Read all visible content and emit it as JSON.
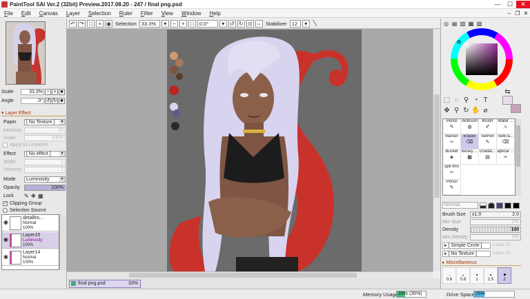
{
  "window": {
    "title": "PaintTool SAI Ver.2 (32bit) Preview.2017.08.20 - 247 / final png.psd",
    "minimize": "—",
    "maximize": "☐",
    "close": "✕"
  },
  "menu": {
    "items": [
      {
        "key": "F",
        "rest": "ile"
      },
      {
        "key": "E",
        "rest": "dit"
      },
      {
        "key": "C",
        "rest": "anvas"
      },
      {
        "key": "L",
        "rest": "ayer"
      },
      {
        "key": "S",
        "rest": "election"
      },
      {
        "key": "R",
        "rest": "uler"
      },
      {
        "key": "F",
        "rest": "ilter"
      },
      {
        "key": "V",
        "rest": "iew"
      },
      {
        "key": "W",
        "rest": "indow"
      },
      {
        "key": "H",
        "rest": "elp"
      }
    ],
    "right": [
      "–",
      "❐",
      "✕"
    ]
  },
  "toolbar": {
    "selection_label": "Selection",
    "zoom": "33.3%",
    "zoom_minus": "−",
    "zoom_plus": "+",
    "rotation": "0.0°",
    "stabilizer_label": "Stabilizer",
    "stabilizer_value": "12"
  },
  "navigator": {
    "scale_label": "Scale",
    "scale_value": "33.3%",
    "angle_label": "Angle",
    "angle_value": "0°"
  },
  "layer_effect": {
    "header": "Layer Effect",
    "paper_label": "Paper",
    "paper_value": "[ No Texture ]",
    "intensity_label": "Intensity",
    "intensity_value": "20",
    "scale_label": "Scale",
    "scale_value": "100%",
    "apply_linework": "Apply to Linework",
    "effect_label": "Effect",
    "effect_value": "[ No effect ]",
    "width_label": "Width",
    "width_value": "1",
    "intensity2_label": "Intensity",
    "intensity2_value": "1"
  },
  "layer_props": {
    "mode_label": "Mode",
    "mode_value": "Luminosity",
    "opacity_label": "Opacity",
    "opacity_value": "100%",
    "opacity_fraction": 1.0,
    "lock_label": "Lock",
    "clipping_group": "Clipping Group",
    "selection_source": "Selection Source"
  },
  "layers": [
    {
      "name": "detalles...",
      "mode": "Normal",
      "opacity": "100%",
      "selected": false
    },
    {
      "name": "Layer15",
      "mode": "Luminosity",
      "opacity": "100%",
      "selected": true
    },
    {
      "name": "Layer14",
      "mode": "Normal",
      "opacity": "100%",
      "selected": false
    }
  ],
  "document_tab": {
    "name": "final png.psd",
    "zoom": "33%"
  },
  "color_panel": {
    "primary_color": "#e8dde8",
    "secondary_color": "#c9a0b8",
    "selected_hue_color": "#6a2a6a"
  },
  "tools": [
    {
      "name": "Pencil",
      "selected": false
    },
    {
      "name": "AirBrush",
      "selected": false
    },
    {
      "name": "Brush",
      "selected": false
    },
    {
      "name": "Water ...",
      "selected": false
    },
    {
      "name": "Marker",
      "selected": false
    },
    {
      "name": "Eraser",
      "selected": true
    },
    {
      "name": "SelPen",
      "selected": false
    },
    {
      "name": "SelEra...",
      "selected": false
    },
    {
      "name": "Bucket",
      "selected": false
    },
    {
      "name": "Binary ...",
      "selected": false
    },
    {
      "name": "Gradat...",
      "selected": false
    },
    {
      "name": "aplicar ...",
      "selected": false
    },
    {
      "name": "apli fino",
      "selected": false
    },
    {
      "name": "Pencil",
      "selected": false
    }
  ],
  "brush": {
    "blend": "Normal",
    "size_label": "Brush Size",
    "size_mult": "x1.0",
    "size_value": "2.0",
    "min_size_label": "Min Size",
    "min_size_value": "0%",
    "density_label": "Density",
    "density_value": "100",
    "density_fraction": 1.0,
    "min_density_label": "Min Density",
    "min_density_value": "0%",
    "shape_value": "[ Simple Circle ]",
    "shape_intensity": "Intens: 50",
    "texture_value": "[ No Texture ]",
    "texture_intensity": "Intens: 95",
    "misc_header": "Miscellaneous",
    "sizes": [
      {
        "label": "0.6",
        "selected": false
      },
      {
        "label": "0.8",
        "selected": false
      },
      {
        "label": "1",
        "selected": false
      },
      {
        "label": "1.5",
        "selected": false
      },
      {
        "label": "2",
        "selected": true
      }
    ]
  },
  "status": {
    "memory_label": "Memory Usage",
    "memory_value": "29% (36%)",
    "memory_fraction": 0.29,
    "drive_label": "Drive Space",
    "drive_value": "26%",
    "drive_fraction": 0.26,
    "usage_color": "#3cc07a",
    "drive_color": "#4ab6e8"
  }
}
